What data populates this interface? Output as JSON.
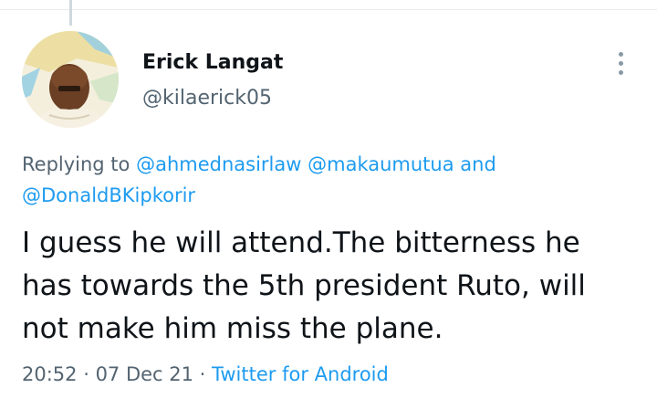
{
  "author": {
    "display_name": "Erick Langat",
    "handle": "@kilaerick05"
  },
  "reply": {
    "prefix": "Replying to ",
    "mentions": [
      "@ahmednasirlaw",
      "@makaumutua",
      "@DonaldBKipkorir"
    ],
    "conjunction": " and"
  },
  "tweet": {
    "lines": [
      "I guess he will attend.The bitterness he",
      "has towards the 5th president Ruto, will",
      "not make him miss the plane."
    ]
  },
  "meta": {
    "time": "20:52",
    "separator": " · ",
    "date": "07 Dec 21",
    "source": "Twitter for Android"
  },
  "icons": {
    "more": "more-vertical-icon"
  },
  "colors": {
    "link": "#1d9bf0",
    "text": "#0f1419",
    "secondary": "#536471"
  }
}
